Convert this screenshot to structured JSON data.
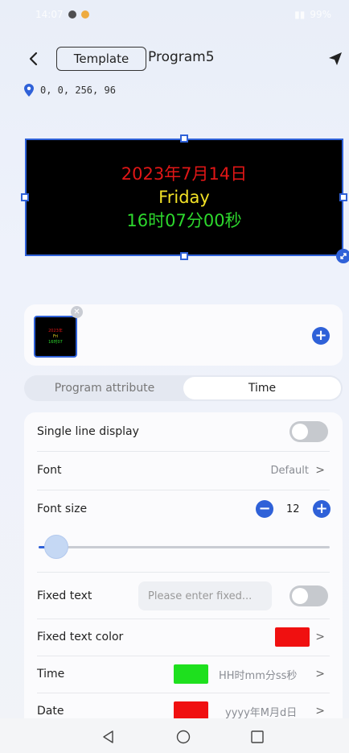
{
  "status_bar": {
    "time": "14:07",
    "battery": "99%"
  },
  "header": {
    "back_icon": "chevron-left-icon",
    "template_label": "Template",
    "program_title": "Program5",
    "send_icon": "send-icon"
  },
  "coords": {
    "icon": "location-pin-icon",
    "text": "0, 0, 256, 96"
  },
  "preview": {
    "date_text": "2023年7月14日",
    "day_text": "Friday",
    "time_text": "16时07分00秒",
    "border_color": "#2f61d8"
  },
  "thumbnail": {
    "date_text": "2023年",
    "day_text": "Fri",
    "time_text": "16时07"
  },
  "tabs": [
    {
      "label": "Program attribute",
      "active": false
    },
    {
      "label": "Time",
      "active": true
    }
  ],
  "settings": {
    "single_line_display": {
      "label": "Single line display",
      "enabled": false
    },
    "font": {
      "label": "Font",
      "value": "Default"
    },
    "font_size": {
      "label": "Font size",
      "value": "12",
      "slider_level": 0.06
    },
    "fixed_text": {
      "label": "Fixed text",
      "placeholder": "Please enter fixed...",
      "enabled": false
    },
    "fixed_text_color": {
      "label": "Fixed text color",
      "color": "#f01010"
    },
    "time": {
      "label": "Time",
      "format": "HH时mm分ss秒",
      "color": "#1ee01e"
    },
    "date": {
      "label": "Date",
      "format": "yyyy年M月d日",
      "color": "#f01010"
    }
  },
  "accent_color": "#2f61d8"
}
